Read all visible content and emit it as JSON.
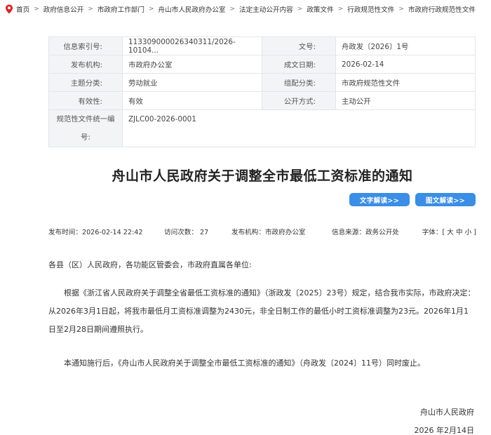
{
  "breadcrumb": {
    "items": [
      "首页",
      "政府信息公开",
      "市政府工作部门",
      "舟山市人民政府办公室",
      "法定主动公开内容",
      "政策文件",
      "行政规范性文件",
      "市政府行政规范性文件"
    ],
    "separator": ">",
    "pin_icon": "location-pin-icon"
  },
  "info": {
    "index_label": "信息索引号:",
    "index_value": "113309000026340311/2026-10104...",
    "doc_no_label": "文号:",
    "doc_no_value": "舟政发〔2026〕1号",
    "issuer_label": "发布机构:",
    "issuer_value": "市政府办公室",
    "date_label": "成文日期:",
    "date_value": "2026-02-14",
    "topic_label": "主题分类:",
    "topic_value": "劳动就业",
    "category_label": "组配分类:",
    "category_value": "市政府规范性文件",
    "validity_label": "有效性:",
    "validity_value": "有效",
    "disclosure_label": "公开方式:",
    "disclosure_value": "主动公开",
    "code_label_line1": "规范性文件统一编",
    "code_label_line2": "号:",
    "code_value": "ZJLC00-2026-0001"
  },
  "title": "舟山市人民政府关于调整全市最低工资标准的通知",
  "buttons": {
    "text_read": "文字解读>>",
    "pic_read": "图文解读>>",
    "color": "#3a8ee6"
  },
  "meta": {
    "publish_time": "发布时间：2026-02-14 22:42",
    "visits": "访问次数：  27",
    "publisher": "发布机构：市政府办公室",
    "source": "信息来源：政务公开处",
    "font_label": "字体：[",
    "font_large": "大",
    "font_medium": "中",
    "font_small": "小",
    "font_end": "]"
  },
  "body": {
    "salutation": "各县（区）人民政府，各功能区管委会，市政府直属各单位:",
    "paragraph1": "根据《浙江省人民政府关于调整全省最低工资标准的通知》（浙政发〔2025〕23号）规定，结合我市实际，市政府决定：从2026年3月1日起，将我市最低月工资标准调整为2430元，非全日制工作的最低小时工资标准调整为23元。2026年1月1 日至2月28日期间遵照执行。",
    "paragraph2": "本通知施行后，《舟山市人民政府关于调整全市最低工资标准的通知》（舟政发〔2024〕11号）同时废止。"
  },
  "signature": {
    "org": "舟山市人民政府",
    "date": "2026 年2月14日"
  }
}
